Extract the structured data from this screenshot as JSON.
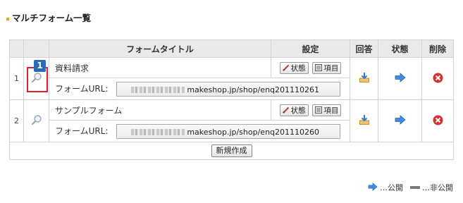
{
  "page": {
    "title": "マルチフォーム一覧"
  },
  "table": {
    "headers": {
      "title": "フォームタイトル",
      "settings": "設定",
      "answers": "回答",
      "status": "状態",
      "delete": "削除"
    },
    "rows": [
      {
        "num": "1",
        "name": "資料請求",
        "status_btn": "状態",
        "item_btn": "項目",
        "url_label": "フォームURL:",
        "url_value": "makeshop.jp/shop/enq201110261"
      },
      {
        "num": "2",
        "name": "サンプルフォーム",
        "status_btn": "状態",
        "item_btn": "項目",
        "url_label": "フォームURL:",
        "url_value": "makeshop.jp/shop/enq201110260"
      }
    ],
    "new_button": "新規作成"
  },
  "annotation": {
    "badge": "1",
    "highlight_color": "#e0202a",
    "badge_color": "#2a6bb8"
  },
  "legend": {
    "public": "…公開",
    "private": "…非公開"
  },
  "icons": [
    "magnifier-icon",
    "pencil-icon",
    "list-icon",
    "download-icon",
    "arrow-right-icon",
    "delete-icon",
    "dash-icon"
  ]
}
